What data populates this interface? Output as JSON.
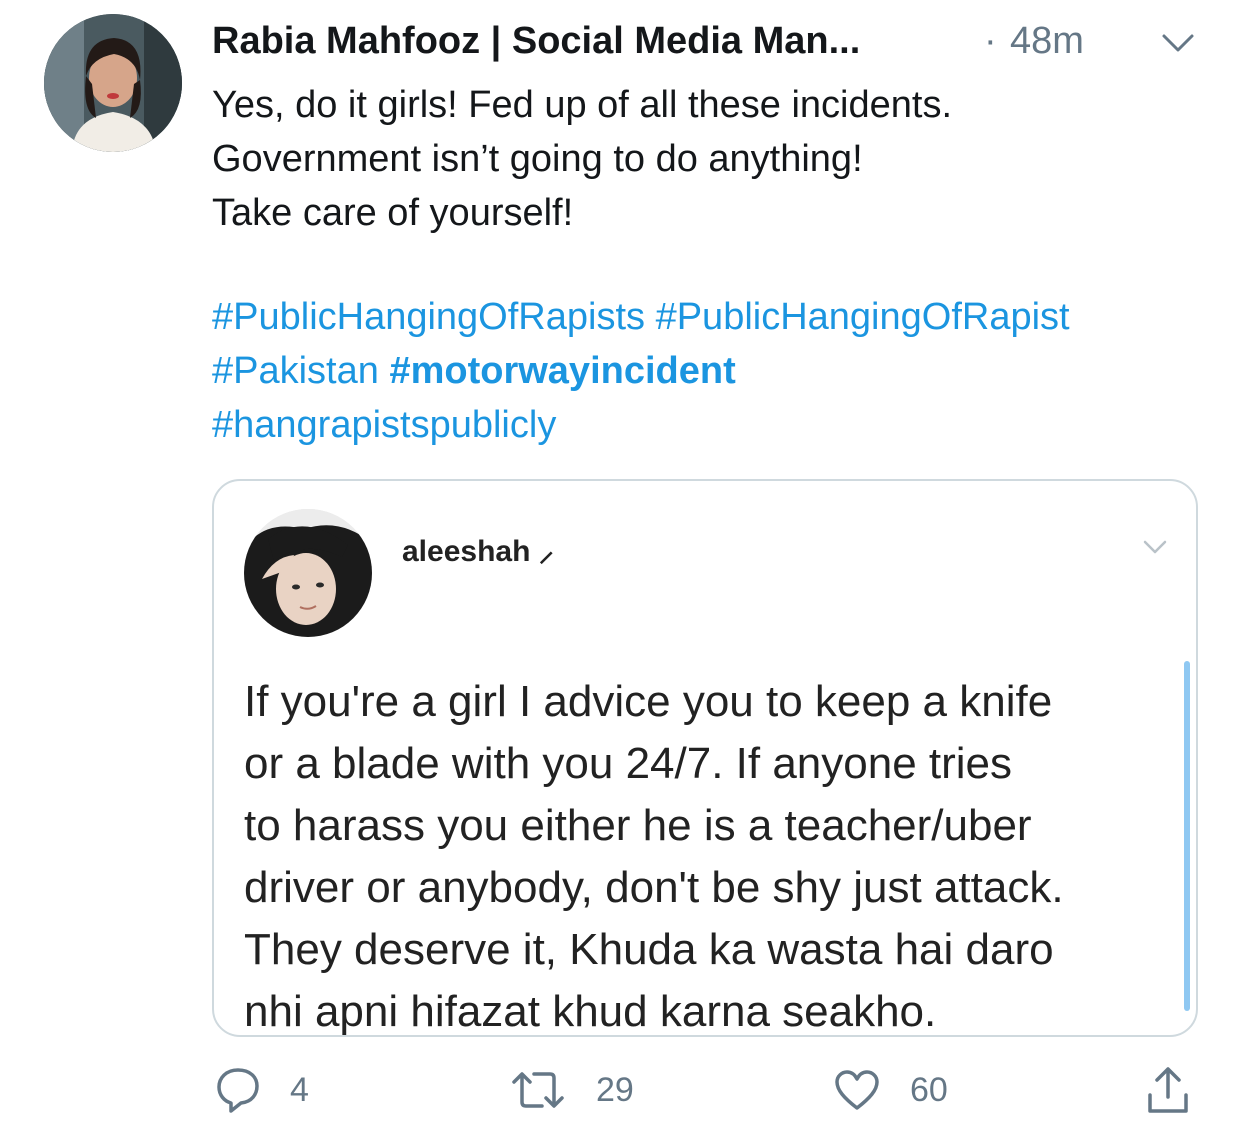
{
  "tweet": {
    "author": "Rabia Mahfooz | Social Media Man...",
    "separator": "·",
    "time": "48m",
    "text_lines": [
      "Yes, do it girls! Fed up of all these incidents.",
      "Government isn’t going to do anything!",
      "Take care of yourself!"
    ],
    "hashtags": {
      "tag1": "#PublicHangingOfRapists",
      "tag2": "#PublicHangingOfRapist",
      "tag3": "#Pakistan",
      "tag4": "#motorwayincident",
      "tag5": "#hangrapistspublicly"
    }
  },
  "quoted": {
    "username": "aleeshah",
    "name_mark": "⸝",
    "body_lines": [
      "If you're a girl I advice you to keep a knife",
      "or a blade with you 24/7. If anyone tries",
      "to harass you either he is a teacher/uber",
      "driver or anybody, don't be shy just attack.",
      "They deserve it, Khuda ka wasta hai daro",
      "nhi apni hifazat khud karna seakho."
    ]
  },
  "actions": {
    "reply_count": "4",
    "retweet_count": "29",
    "like_count": "60"
  },
  "icons": {
    "menu": "chevron-down-icon",
    "reply": "reply-icon",
    "retweet": "retweet-icon",
    "like": "heart-icon",
    "share": "share-icon"
  },
  "colors": {
    "link": "#1b95e0",
    "secondary": "#657786",
    "border": "#cfd9de"
  }
}
